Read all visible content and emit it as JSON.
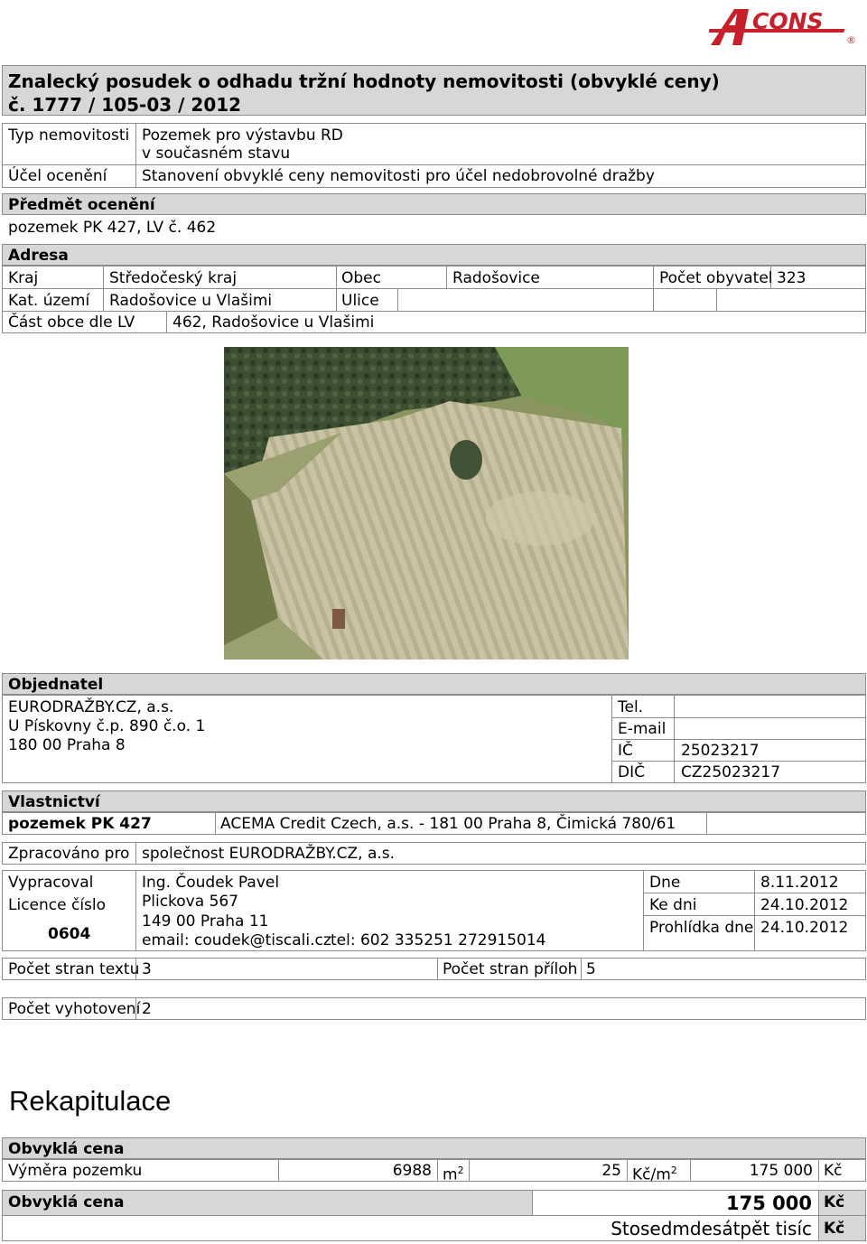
{
  "logo": {
    "text": "CONS",
    "letter": "A",
    "mark": "®",
    "color": "#c8202a"
  },
  "header": {
    "title_line1": "Znalecký posudek o odhadu tržní hodnoty nemovitosti (obvyklé ceny)",
    "title_line2": "č.  1777 / 105-03 / 2012"
  },
  "property": {
    "type_label": "Typ nemovitosti",
    "type_value_1": "Pozemek pro výstavbu RD",
    "type_value_2": "v současném stavu",
    "purpose_label": "Účel ocenění",
    "purpose_value": "Stanovení obvyklé ceny nemovitosti pro účel nedobrovolné dražby"
  },
  "subject": {
    "label": "Předmět ocenění",
    "value": "pozemek PK 427, LV č. 462"
  },
  "address": {
    "label": "Adresa",
    "kraj_label": "Kraj",
    "kraj_value": "Středočeský kraj",
    "obec_label": "Obec",
    "obec_value": "Radošovice",
    "pocet_label": "Počet obyvatel",
    "pocet_value": "323",
    "kat_label": "Kat. území",
    "kat_value": "Radošovice u Vlašimi",
    "ulice_label": "Ulice",
    "ulice_value": "",
    "cast_label": "Část obce dle LV",
    "cast_value": "462, Radošovice u Vlašimi"
  },
  "orderer": {
    "label": "Objednatel",
    "name": "EURODRAŽBY.CZ, a.s.",
    "street": "U Pískovny č.p. 890 č.o. 1",
    "city": "180 00  Praha 8",
    "tel_label": "Tel.",
    "tel_value": "",
    "email_label": "E-mail",
    "email_value": "",
    "ic_label": "IČ",
    "ic_value": "25023217",
    "dic_label": "DIČ",
    "dic_value": "CZ25023217"
  },
  "ownership": {
    "label": "Vlastnictví",
    "item": "pozemek PK 427",
    "owner": "ACEMA Credit Czech, a.s. - 181 00 Praha 8, Čimická 780/61"
  },
  "processed": {
    "label": "Zpracováno pro",
    "value": "společnost EURODRAŽBY.CZ, a.s."
  },
  "author": {
    "label": "Vypracoval",
    "license_label": "Licence číslo",
    "license_value": "0604",
    "name": "Ing. Čoudek Pavel",
    "street": "Plickova 567",
    "city": "149 00 Praha 11",
    "email": "email: coudek@tiscali.cz",
    "tel": "tel: 602 335251  272915014",
    "dne_label": "Dne",
    "dne_value": "8.11.2012",
    "kedni_label": "Ke dni",
    "kedni_value": "24.10.2012",
    "prohlidka_label": "Prohlídka dne",
    "prohlidka_value": "24.10.2012"
  },
  "pages": {
    "text_label": "Počet stran textu",
    "text_value": "3",
    "attach_label": "Počet stran příloh",
    "attach_value": "5"
  },
  "copies": {
    "label": "Počet vyhotovení",
    "value": "2"
  },
  "recap": {
    "heading": "Rekapitulace",
    "section_label": "Obvyklá cena",
    "row_label": "Výměra pozemku",
    "area_value": "6988",
    "area_unit": "m",
    "area_unit_sup": "2",
    "price_value": "25",
    "price_unit": "Kč/m",
    "price_unit_sup": "2",
    "total_value": "175 000",
    "total_unit": "Kč",
    "final_label": "Obvyklá cena",
    "final_value": "175 000",
    "final_unit": "Kč",
    "words": "Stosedmdesátpět tisíc",
    "words_unit": "Kč"
  }
}
